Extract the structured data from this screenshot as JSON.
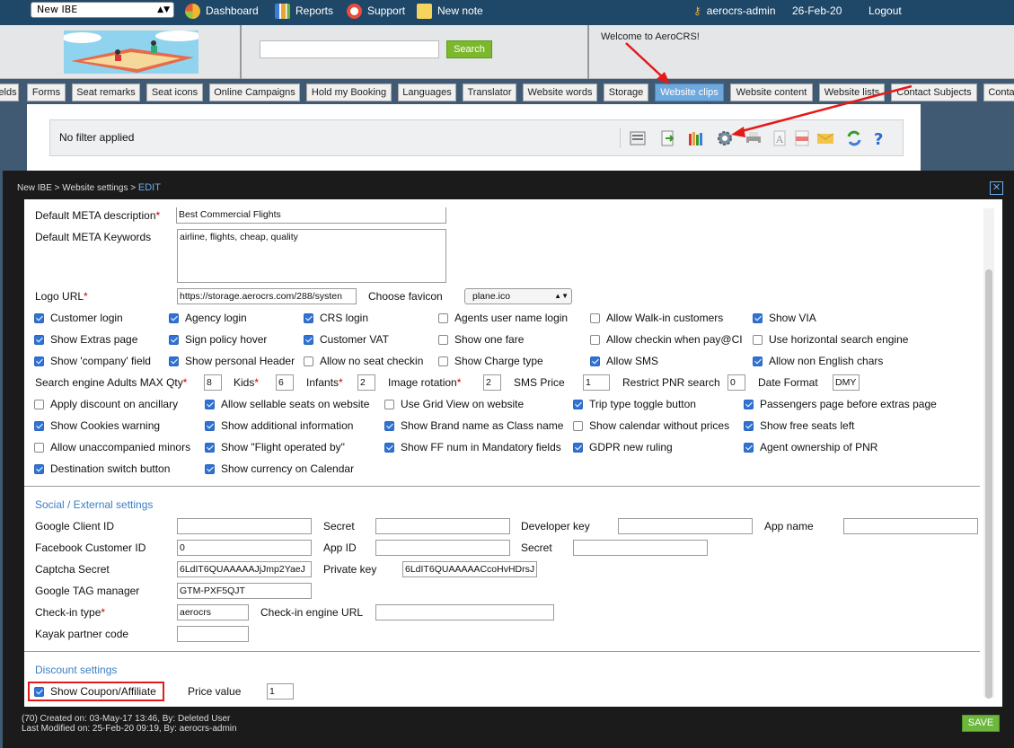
{
  "topbar": {
    "ibe_select": "New IBE",
    "dashboard": "Dashboard",
    "reports": "Reports",
    "support": "Support",
    "new_note": "New note",
    "user": "aerocrs-admin",
    "date": "26-Feb-20",
    "logout": "Logout"
  },
  "header": {
    "search_button": "Search",
    "search_value": "",
    "welcome": "Welcome to AeroCRS!"
  },
  "tabs": [
    "elds",
    "Forms",
    "Seat remarks",
    "Seat icons",
    "Online Campaigns",
    "Hold my Booking",
    "Languages",
    "Translator",
    "Website words",
    "Storage",
    "Website clips",
    "Website content",
    "Website lists",
    "Contact Subjects",
    "Conta"
  ],
  "active_tab": "Website clips",
  "filter": {
    "label": "No filter applied"
  },
  "toolbar_icons": [
    "report-icon",
    "export-icon",
    "columns-icon",
    "settings-gear-icon",
    "print-icon",
    "text-icon",
    "pdf-icon",
    "email-icon",
    "refresh-icon",
    "help-icon"
  ],
  "modal": {
    "breadcrumb": "New IBE > Website settings > ",
    "breadcrumb_edit": "EDIT",
    "close": "✕"
  },
  "form": {
    "meta_description_label": "Default META description",
    "meta_description": "Best Commercial Flights",
    "meta_keywords_label": "Default META Keywords",
    "meta_keywords": "airline, flights, cheap, quality",
    "logo_url_label": "Logo URL",
    "logo_url": "https://storage.aerocrs.com/288/systen",
    "favicon_label": "Choose favicon",
    "favicon": "plane.ico",
    "checkboxes": [
      {
        "label": "Customer login",
        "checked": true
      },
      {
        "label": "Agency login",
        "checked": true
      },
      {
        "label": "CRS login",
        "checked": true
      },
      {
        "label": "Agents user name login",
        "checked": false
      },
      {
        "label": "Allow Walk-in customers",
        "checked": false
      },
      {
        "label": "Show VIA",
        "checked": true
      },
      {
        "label": "Show Extras page",
        "checked": true
      },
      {
        "label": "Sign policy hover",
        "checked": true
      },
      {
        "label": "Customer VAT",
        "checked": true
      },
      {
        "label": "Show one fare",
        "checked": false
      },
      {
        "label": "Allow checkin when pay@CI",
        "checked": false
      },
      {
        "label": "Use horizontal search engine",
        "checked": false
      },
      {
        "label": "Show 'company' field",
        "checked": true
      },
      {
        "label": "Show personal Header",
        "checked": true
      },
      {
        "label": "Allow no seat checkin",
        "checked": false
      },
      {
        "label": "Show Charge type",
        "checked": false
      },
      {
        "label": "Allow SMS",
        "checked": true
      },
      {
        "label": "Allow non English chars",
        "checked": true
      }
    ],
    "numeric": {
      "adults_label": "Search engine Adults MAX Qty",
      "adults": "8",
      "kids_label": "Kids",
      "kids": "6",
      "infants_label": "Infants",
      "infants": "2",
      "rotation_label": "Image rotation",
      "rotation": "2",
      "sms_label": "SMS Price",
      "sms": "1",
      "pnr_label": "Restrict PNR search",
      "pnr": "0",
      "date_label": "Date Format",
      "date": "DMY"
    },
    "checkboxes2": [
      {
        "label": "Apply discount on ancillary",
        "checked": false
      },
      {
        "label": "Allow sellable seats on website",
        "checked": true
      },
      {
        "label": "Use Grid View on website",
        "checked": false
      },
      {
        "label": "Trip type toggle button",
        "checked": true
      },
      {
        "label": "Passengers page before extras page",
        "checked": true
      },
      {
        "label": "Show Cookies warning",
        "checked": true
      },
      {
        "label": "Show additional information",
        "checked": true
      },
      {
        "label": "Show Brand name as Class name",
        "checked": true
      },
      {
        "label": "Show calendar without prices",
        "checked": false
      },
      {
        "label": "Show free seats left",
        "checked": true
      },
      {
        "label": "Allow unaccompanied minors",
        "checked": false
      },
      {
        "label": "Show \"Flight operated by\"",
        "checked": true
      },
      {
        "label": "Show FF num in Mandatory fields",
        "checked": true
      },
      {
        "label": "GDPR new ruling",
        "checked": true
      },
      {
        "label": "Agent ownership of PNR",
        "checked": true
      },
      {
        "label": "Destination switch button",
        "checked": true
      },
      {
        "label": "Show currency on Calendar",
        "checked": true
      }
    ],
    "social": {
      "title": "Social / External settings",
      "google_client_label": "Google Client ID",
      "google_client": "",
      "secret_label": "Secret",
      "secret": "",
      "dev_key_label": "Developer key",
      "dev_key": "",
      "app_name_label": "App name",
      "app_name": "",
      "fb_label": "Facebook Customer ID",
      "fb": "0",
      "app_id_label": "App ID",
      "app_id": "",
      "fb_secret_label": "Secret",
      "fb_secret": "",
      "captcha_label": "Captcha Secret",
      "captcha": "6LdIT6QUAAAAAJjJmp2YaeJ",
      "private_key_label": "Private key",
      "private_key": "6LdIT6QUAAAAACcoHvHDrsJ",
      "gtm_label": "Google TAG manager",
      "gtm": "GTM-PXF5QJT",
      "checkin_type_label": "Check-in type",
      "checkin_type": "aerocrs",
      "checkin_url_label": "Check-in engine URL",
      "checkin_url": "",
      "kayak_label": "Kayak partner code",
      "kayak": ""
    },
    "discount": {
      "title": "Discount settings",
      "coupon_label": "Show Coupon/Affiliate",
      "coupon_checked": true,
      "price_label": "Price value",
      "price": "1"
    }
  },
  "footer": {
    "created": "(70) Created on: 03-May-17 13:46, By: Deleted User",
    "modified": "Last Modified on: 25-Feb-20 09:19, By: aerocrs-admin",
    "save": "SAVE"
  },
  "colors": {
    "topbar": "#1f4767",
    "accent": "#6fa8dc",
    "save": "#6db83c",
    "annotation": "#e31a1a"
  }
}
